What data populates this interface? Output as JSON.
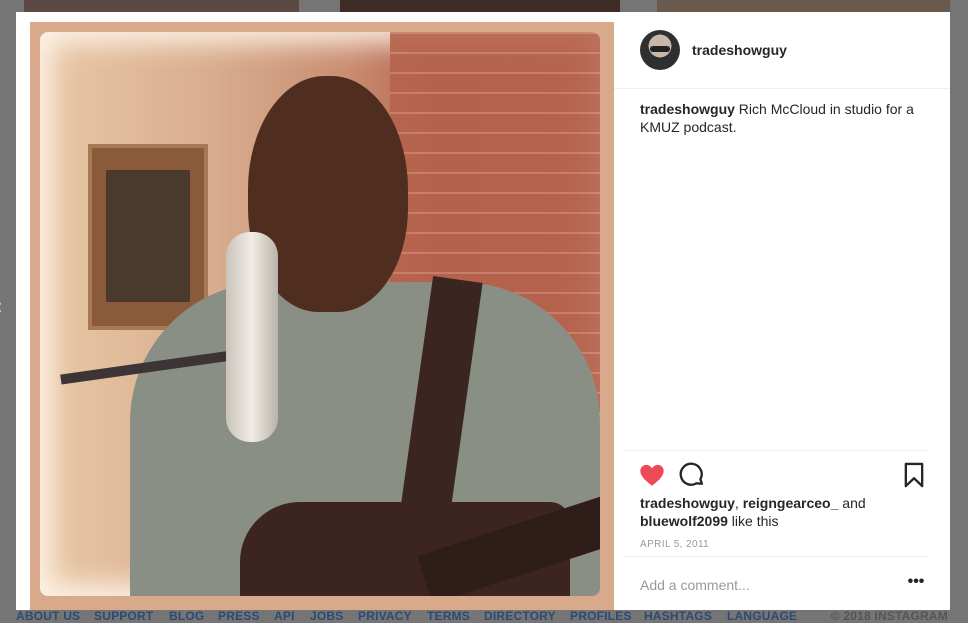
{
  "post": {
    "username": "tradeshowguy",
    "caption_user": "tradeshowguy",
    "caption_text": " Rich McCloud in studio for a KMUZ podcast.",
    "likes": {
      "user1": "tradeshowguy",
      "sep1": ", ",
      "user2": "reigngearceo_",
      "and": " and ",
      "user3": "bluewolf2099",
      "suffix": " like this"
    },
    "date": "APRIL 5, 2011",
    "liked": true,
    "comment_placeholder": "Add a comment..."
  },
  "icons": {
    "heart": "heart-icon",
    "comment": "comment-icon",
    "bookmark": "bookmark-icon",
    "more": "more-icon",
    "prev": "chevron-left-icon"
  },
  "footer": {
    "links": [
      "ABOUT US",
      "SUPPORT",
      "BLOG",
      "PRESS",
      "API",
      "JOBS",
      "PRIVACY",
      "TERMS",
      "DIRECTORY",
      "PROFILES",
      "HASHTAGS",
      "LANGUAGE"
    ],
    "copyright": "© 2018 INSTAGRAM"
  },
  "colors": {
    "heart": "#ed4956",
    "footer_link": "#2d4a72",
    "overlay": "#757575"
  }
}
